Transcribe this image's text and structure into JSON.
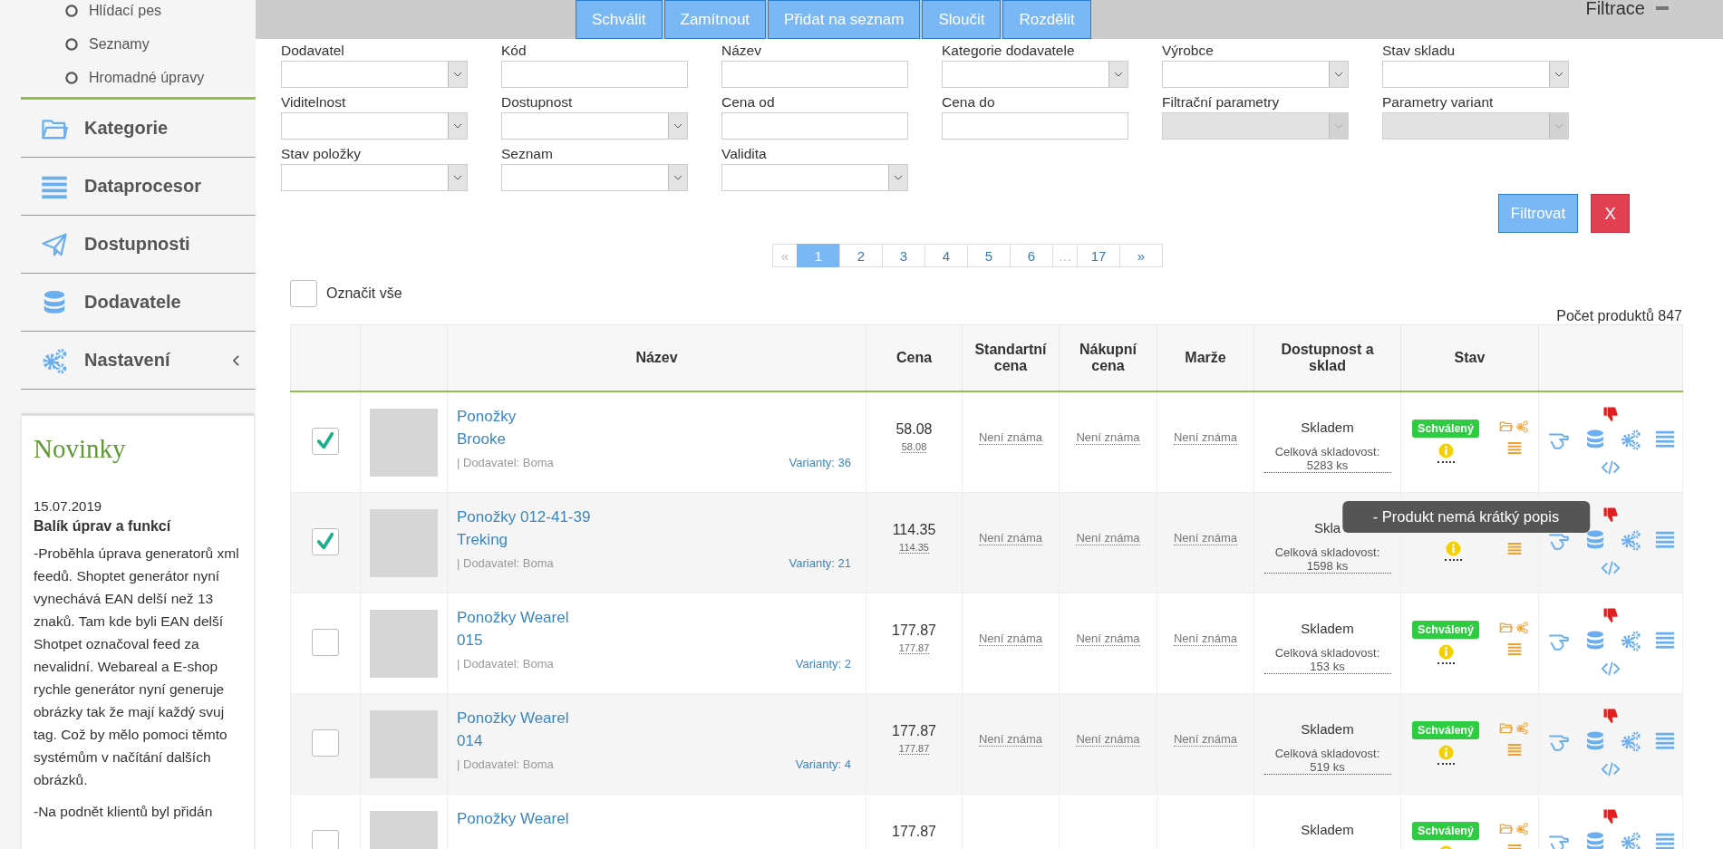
{
  "sidebar": {
    "subitems": [
      {
        "label": "Hlídací pes"
      },
      {
        "label": "Seznamy"
      },
      {
        "label": "Hromadné úpravy"
      }
    ],
    "menu": [
      {
        "label": "Kategorie",
        "has_submenu": false
      },
      {
        "label": "Dataprocesor",
        "has_submenu": false
      },
      {
        "label": "Dostupnosti",
        "has_submenu": false
      },
      {
        "label": "Dodavatele",
        "has_submenu": false
      },
      {
        "label": "Nastavení",
        "has_submenu": true
      }
    ],
    "news": {
      "heading": "Novinky",
      "date": "15.07.2019",
      "title": "Balík úprav a funkcí",
      "paragraphs": [
        "-Proběhla úprava generatorů xml feedů. Shoptet generátor nyní vynechává EAN delší než 13 znaků. Tam kde byli EAN delší Shotpet označoval feed za nevalidní. Webareal a E-shop rychle generátor nyní generuje obrázky tak že mají každý svuj tag. Což by mělo pomoci těmto systémům v načítání dalších obrázků.",
        "-Na podnět klientů byl přidán"
      ]
    }
  },
  "toolbar": {
    "actions": [
      "Schválit",
      "Zamítnout",
      "Přidat na seznam",
      "Sloučit",
      "Rozdělit"
    ],
    "filter_title": "Filtrace",
    "filter_expanded": true
  },
  "filters": [
    {
      "label": "Dodavatel",
      "kind": "select",
      "disabled": false
    },
    {
      "label": "Kód",
      "kind": "text",
      "disabled": false
    },
    {
      "label": "Název",
      "kind": "text",
      "disabled": false
    },
    {
      "label": "Kategorie dodavatele",
      "kind": "select",
      "disabled": false
    },
    {
      "label": "Výrobce",
      "kind": "select",
      "disabled": false
    },
    {
      "label": "Stav skladu",
      "kind": "select",
      "disabled": false
    },
    {
      "label": "Viditelnost",
      "kind": "select",
      "disabled": false
    },
    {
      "label": "Dostupnost",
      "kind": "select",
      "disabled": false
    },
    {
      "label": "Cena od",
      "kind": "text",
      "disabled": false
    },
    {
      "label": "Cena do",
      "kind": "text",
      "disabled": false
    },
    {
      "label": "Filtrační parametry",
      "kind": "select",
      "disabled": true
    },
    {
      "label": "Parametry variant",
      "kind": "select",
      "disabled": true
    },
    {
      "label": "Stav položky",
      "kind": "select",
      "disabled": false
    },
    {
      "label": "Seznam",
      "kind": "select",
      "disabled": false
    },
    {
      "label": "Validita",
      "kind": "select",
      "disabled": false
    }
  ],
  "filter_buttons": {
    "apply": "Filtrovat",
    "clear": "X"
  },
  "pagination": [
    {
      "label": "«",
      "selected": false,
      "disabled": true
    },
    {
      "label": "1",
      "selected": true,
      "disabled": false
    },
    {
      "label": "2",
      "selected": false,
      "disabled": false
    },
    {
      "label": "3",
      "selected": false,
      "disabled": false
    },
    {
      "label": "4",
      "selected": false,
      "disabled": false
    },
    {
      "label": "5",
      "selected": false,
      "disabled": false
    },
    {
      "label": "6",
      "selected": false,
      "disabled": false
    },
    {
      "label": "…",
      "selected": false,
      "disabled": true
    },
    {
      "label": "17",
      "selected": false,
      "disabled": false
    },
    {
      "label": "»",
      "selected": false,
      "disabled": false
    }
  ],
  "select_all": {
    "label": "Označit vše",
    "checked": false
  },
  "product_count": "Počet produktů 847",
  "table": {
    "columns": [
      "Název",
      "Cena",
      "Standartní cena",
      "Nákupní cena",
      "Marže",
      "Dostupnost a sklad",
      "Stav"
    ],
    "rows": [
      {
        "checked": true,
        "name_lines": [
          "Ponožky",
          "Brooke"
        ],
        "supplier": "| Dodavatel: Boma",
        "variants": "Varianty: 36",
        "price": "58.08",
        "price_sub": "58.08",
        "standard_price": "Není známa",
        "purchase_price": "Není známa",
        "margin": "Není známa",
        "availability": "Skladem",
        "stock": "Celková skladovost: 5283 ks",
        "badge": "Schválený"
      },
      {
        "checked": true,
        "name_lines": [
          "Ponožky 012-41-39",
          "Treking"
        ],
        "supplier": "| Dodavatel: Boma",
        "variants": "Varianty: 21",
        "price": "114.35",
        "price_sub": "114.35",
        "standard_price": "Není známa",
        "purchase_price": "Není známa",
        "margin": "Není známa",
        "availability": "Skla",
        "stock": "Celková skladovost: 1598 ks",
        "tooltip": "- Produkt nemá krátký popis"
      },
      {
        "checked": false,
        "name_lines": [
          "Ponožky Wearel",
          "015"
        ],
        "supplier": "| Dodavatel: Boma",
        "variants": "Varianty: 2",
        "price": "177.87",
        "price_sub": "177.87",
        "standard_price": "Není známa",
        "purchase_price": "Není známa",
        "margin": "Není známa",
        "availability": "Skladem",
        "stock": "Celková skladovost: 153 ks",
        "badge": "Schválený"
      },
      {
        "checked": false,
        "name_lines": [
          "Ponožky Wearel",
          "014"
        ],
        "supplier": "| Dodavatel: Boma",
        "variants": "Varianty: 4",
        "price": "177.87",
        "price_sub": "177.87",
        "standard_price": "Není známa",
        "purchase_price": "Není známa",
        "margin": "Není známa",
        "availability": "Skladem",
        "stock": "Celková skladovost: 519 ks",
        "badge": "Schválený"
      },
      {
        "checked": false,
        "name_lines": [
          "Ponožky Wearel"
        ],
        "price": "177.87",
        "availability": "Skladem",
        "badge": "Schválený"
      }
    ]
  }
}
